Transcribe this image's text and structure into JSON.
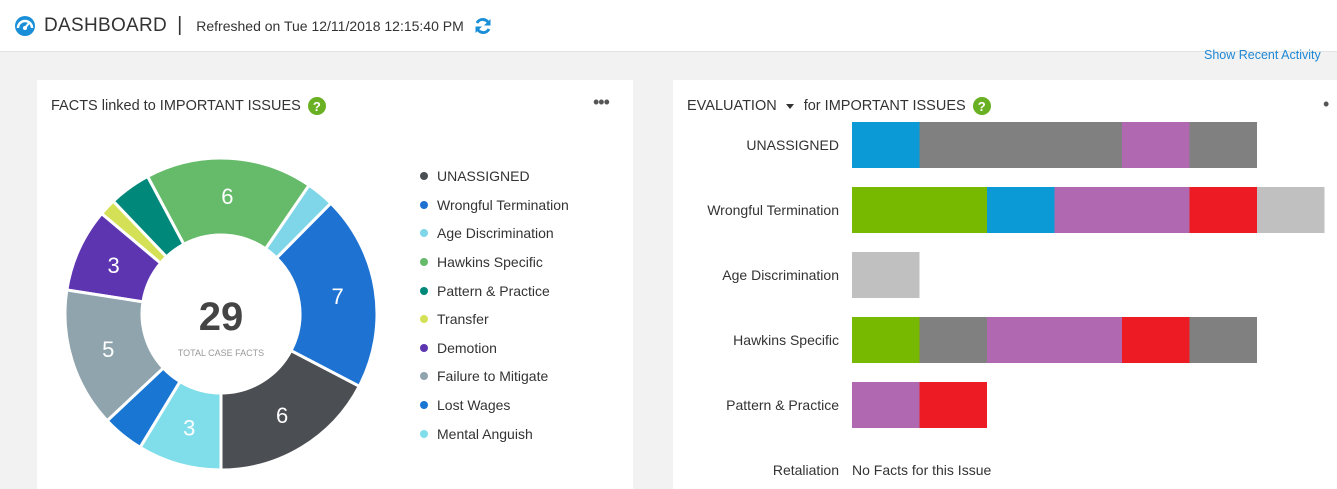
{
  "header": {
    "title": "DASHBOARD",
    "separator": "|",
    "refreshed": "Refreshed on Tue 12/11/2018 12:15:40 PM",
    "show_recent": "Show Recent Activity"
  },
  "left_panel": {
    "title": "FACTS linked to IMPORTANT ISSUES",
    "help": "?",
    "menu": "•••",
    "total": "29",
    "total_label": "TOTAL CASE FACTS",
    "legend": [
      {
        "label": "UNASSIGNED",
        "color": "#4b4e52"
      },
      {
        "label": "Wrongful Termination",
        "color": "#1e73d2"
      },
      {
        "label": "Age Discrimination",
        "color": "#7fd6e8"
      },
      {
        "label": "Hawkins Specific",
        "color": "#66bb6a"
      },
      {
        "label": "Pattern & Practice",
        "color": "#00897b"
      },
      {
        "label": "Transfer",
        "color": "#d4e157"
      },
      {
        "label": "Demotion",
        "color": "#5e35b1"
      },
      {
        "label": "Failure to Mitigate",
        "color": "#90a4ae"
      },
      {
        "label": "Lost Wages",
        "color": "#1976d2"
      },
      {
        "label": "Mental Anguish",
        "color": "#80deea"
      }
    ]
  },
  "chart_data": {
    "type": "pie",
    "slices": [
      {
        "name": "UNASSIGNED",
        "value": 6,
        "label": "6",
        "color": "#4b4e52"
      },
      {
        "name": "Wrongful Termination",
        "value": 7,
        "label": "7",
        "color": "#1e73d2"
      },
      {
        "name": "Age Discrimination",
        "value": 1,
        "label": "",
        "color": "#7fd6e8"
      },
      {
        "name": "Hawkins Specific",
        "value": 6,
        "label": "6",
        "color": "#66bb6a"
      },
      {
        "name": "Pattern & Practice",
        "value": 1.5,
        "label": "",
        "color": "#00897b"
      },
      {
        "name": "Transfer",
        "value": 0.6,
        "label": "",
        "color": "#d4e157"
      },
      {
        "name": "Demotion",
        "value": 3,
        "label": "3",
        "color": "#5e35b1"
      },
      {
        "name": "Failure to Mitigate",
        "value": 5,
        "label": "5",
        "color": "#90a4ae"
      },
      {
        "name": "Lost Wages",
        "value": 1.5,
        "label": "",
        "color": "#1976d2"
      },
      {
        "name": "Mental Anguish",
        "value": 3,
        "label": "3",
        "color": "#80deea"
      }
    ]
  },
  "right_panel": {
    "title_dropdown": "EVALUATION",
    "title_rest": "for IMPORTANT ISSUES",
    "help": "?",
    "menu": "•",
    "no_facts": "No Facts for this Issue",
    "issues": [
      {
        "label": "UNASSIGNED",
        "segments": [
          {
            "value": 1,
            "color": "#0c9ad6"
          },
          {
            "value": 3,
            "color": "#808080"
          },
          {
            "value": 1,
            "color": "#b068b0"
          },
          {
            "value": 1,
            "color": "#808080"
          }
        ]
      },
      {
        "label": "Wrongful Termination",
        "segments": [
          {
            "value": 2,
            "color": "#76b900"
          },
          {
            "value": 1,
            "color": "#0c9ad6"
          },
          {
            "value": 2,
            "color": "#b068b0"
          },
          {
            "value": 1,
            "color": "#ed1c24"
          },
          {
            "value": 1,
            "color": "#c0c0c0"
          }
        ]
      },
      {
        "label": "Age Discrimination",
        "segments": [
          {
            "value": 1,
            "color": "#c0c0c0"
          }
        ]
      },
      {
        "label": "Hawkins Specific",
        "segments": [
          {
            "value": 1,
            "color": "#76b900"
          },
          {
            "value": 1,
            "color": "#808080"
          },
          {
            "value": 2,
            "color": "#b068b0"
          },
          {
            "value": 1,
            "color": "#ed1c24"
          },
          {
            "value": 1,
            "color": "#808080"
          }
        ]
      },
      {
        "label": "Pattern & Practice",
        "segments": [
          {
            "value": 1,
            "color": "#b068b0"
          },
          {
            "value": 1,
            "color": "#ed1c24"
          }
        ]
      },
      {
        "label": "Retaliation",
        "segments": []
      }
    ]
  }
}
